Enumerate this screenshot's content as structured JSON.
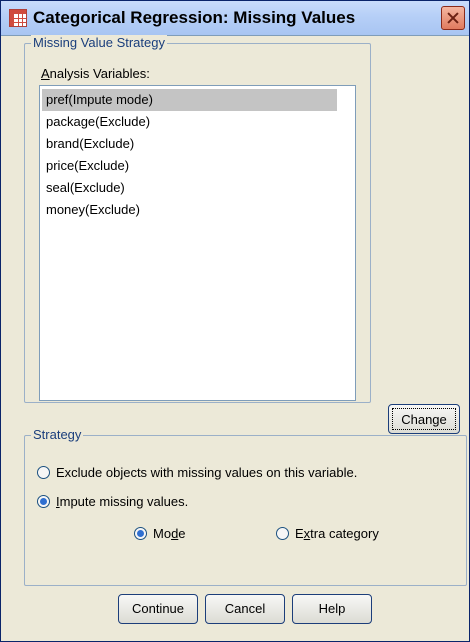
{
  "window": {
    "title": "Categorical Regression: Missing Values"
  },
  "missing_value_strategy": {
    "legend": "Missing Value Strategy",
    "analysis_variables_label": "Analysis Variables:",
    "items": [
      {
        "label": "pref(Impute mode)",
        "selected": true
      },
      {
        "label": "package(Exclude)",
        "selected": false
      },
      {
        "label": "brand(Exclude)",
        "selected": false
      },
      {
        "label": "price(Exclude)",
        "selected": false
      },
      {
        "label": "seal(Exclude)",
        "selected": false
      },
      {
        "label": "money(Exclude)",
        "selected": false
      }
    ],
    "change_label": "Change"
  },
  "strategy": {
    "legend": "Strategy",
    "exclude_label": "Exclude objects with missing values on this variable.",
    "impute_label": "Impute missing values.",
    "mode_label": "Mode",
    "extra_category_label": "Extra category",
    "selected_option": "impute",
    "impute_method": "mode"
  },
  "buttons": {
    "continue": "Continue",
    "cancel": "Cancel",
    "help": "Help"
  }
}
